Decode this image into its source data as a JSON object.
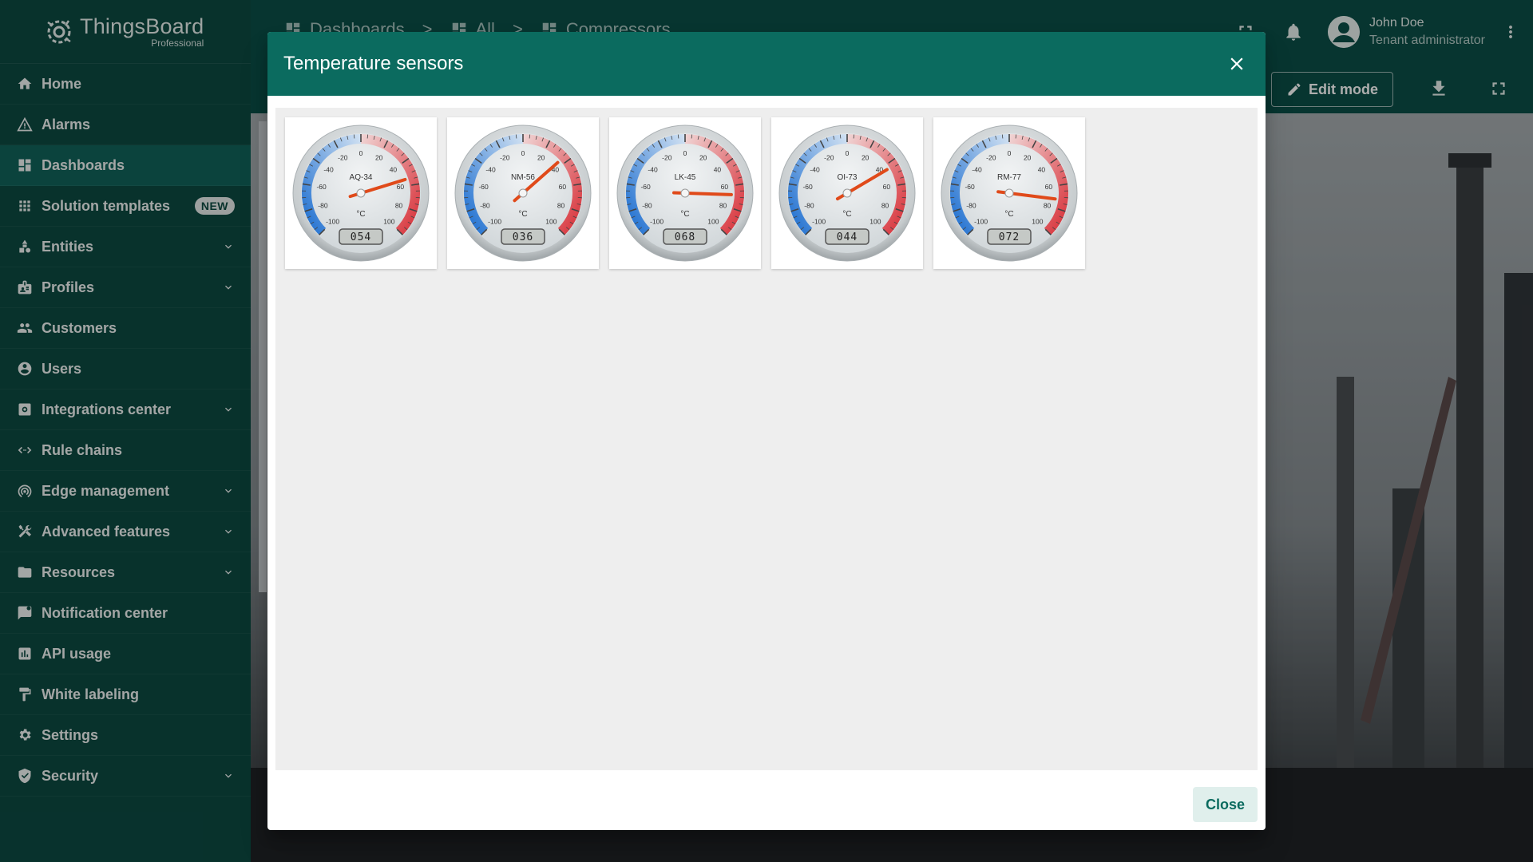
{
  "app": {
    "logo_name": "ThingsBoard",
    "logo_sub": "Professional"
  },
  "sidebar": {
    "items": [
      {
        "label": "Home",
        "icon": "home-icon"
      },
      {
        "label": "Alarms",
        "icon": "alarm-warning-icon"
      },
      {
        "label": "Dashboards",
        "icon": "dashboard-icon",
        "active": true
      },
      {
        "label": "Solution templates",
        "icon": "apps-grid-icon",
        "badge": "NEW"
      },
      {
        "label": "Entities",
        "icon": "entities-icon",
        "expandable": true
      },
      {
        "label": "Profiles",
        "icon": "profiles-icon",
        "expandable": true
      },
      {
        "label": "Customers",
        "icon": "customers-icon"
      },
      {
        "label": "Users",
        "icon": "user-account-icon"
      },
      {
        "label": "Integrations center",
        "icon": "integrations-icon",
        "expandable": true
      },
      {
        "label": "Rule chains",
        "icon": "rule-chain-icon"
      },
      {
        "label": "Edge management",
        "icon": "edge-icon",
        "expandable": true
      },
      {
        "label": "Advanced features",
        "icon": "tools-icon",
        "expandable": true
      },
      {
        "label": "Resources",
        "icon": "folder-icon",
        "expandable": true
      },
      {
        "label": "Notification center",
        "icon": "notification-center-icon"
      },
      {
        "label": "API usage",
        "icon": "api-usage-icon"
      },
      {
        "label": "White labeling",
        "icon": "paint-roller-icon"
      },
      {
        "label": "Settings",
        "icon": "gear-icon"
      },
      {
        "label": "Security",
        "icon": "shield-icon",
        "expandable": true
      }
    ]
  },
  "header": {
    "breadcrumbs": [
      "Dashboards",
      "All",
      "Compressors"
    ],
    "separator": ">",
    "user_name": "John Doe",
    "user_role": "Tenant administrator"
  },
  "dashboard": {
    "edit_mode_label": "Edit mode"
  },
  "dialog": {
    "title": "Temperature sensors",
    "close_label": "Close",
    "gauges": [
      {
        "name": "AQ-34",
        "value": 54,
        "display": "054",
        "unit": "°C"
      },
      {
        "name": "NM-56",
        "value": 36,
        "display": "036",
        "unit": "°C"
      },
      {
        "name": "LK-45",
        "value": 68,
        "display": "068",
        "unit": "°C"
      },
      {
        "name": "OI-73",
        "value": 44,
        "display": "044",
        "unit": "°C"
      },
      {
        "name": "RM-77",
        "value": 72,
        "display": "072",
        "unit": "°C"
      }
    ],
    "gauge_scale": {
      "min": -100,
      "max": 100,
      "ticks": [
        -100,
        -80,
        -60,
        -40,
        -20,
        0,
        20,
        40,
        60,
        80,
        100
      ]
    }
  },
  "colors": {
    "primary": "#0b6b5f",
    "sidebar": "#0c4a42",
    "gauge_cold": "#1e6fd0",
    "gauge_hot": "#d8323a",
    "needle": "#e04a1a"
  }
}
